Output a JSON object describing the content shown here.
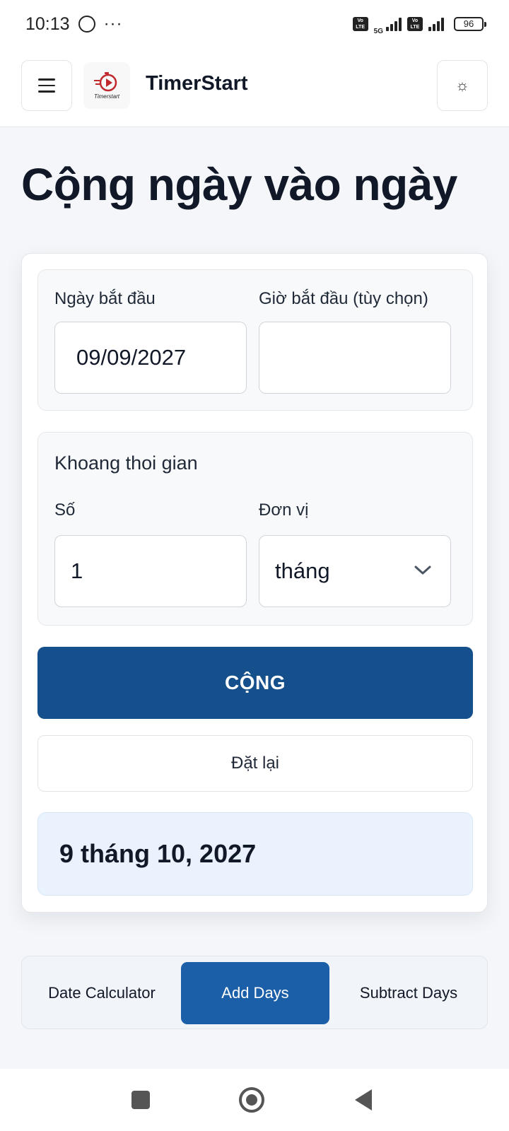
{
  "status_bar": {
    "time": "10:13",
    "dots": "···",
    "volte_label": "Vo LTE",
    "network": "5G",
    "battery": "96"
  },
  "header": {
    "app_name": "TimerStart",
    "logo_text": "Timerstart",
    "brand_color": "#c0282d"
  },
  "page": {
    "title": "Cộng ngày vào ngày"
  },
  "form": {
    "start_date_label": "Ngày bắt đầu",
    "start_date_value": "09/09/2027",
    "start_time_label": "Giờ bắt đầu (tùy chọn)",
    "start_time_value": "",
    "interval_heading": "Khoang thoi gian",
    "number_label": "Số",
    "number_value": "1",
    "unit_label": "Đơn vị",
    "unit_value": "tháng",
    "add_button": "CỘNG",
    "reset_button": "Đặt lại",
    "result": "9 tháng 10, 2027"
  },
  "tabs": [
    {
      "label": "Date Calculator",
      "active": false
    },
    {
      "label": "Add Days",
      "active": true
    },
    {
      "label": "Subtract Days",
      "active": false
    }
  ],
  "colors": {
    "primary_button": "#154f8c",
    "active_tab": "#1a5fa8",
    "result_background": "#eaf3fd"
  }
}
